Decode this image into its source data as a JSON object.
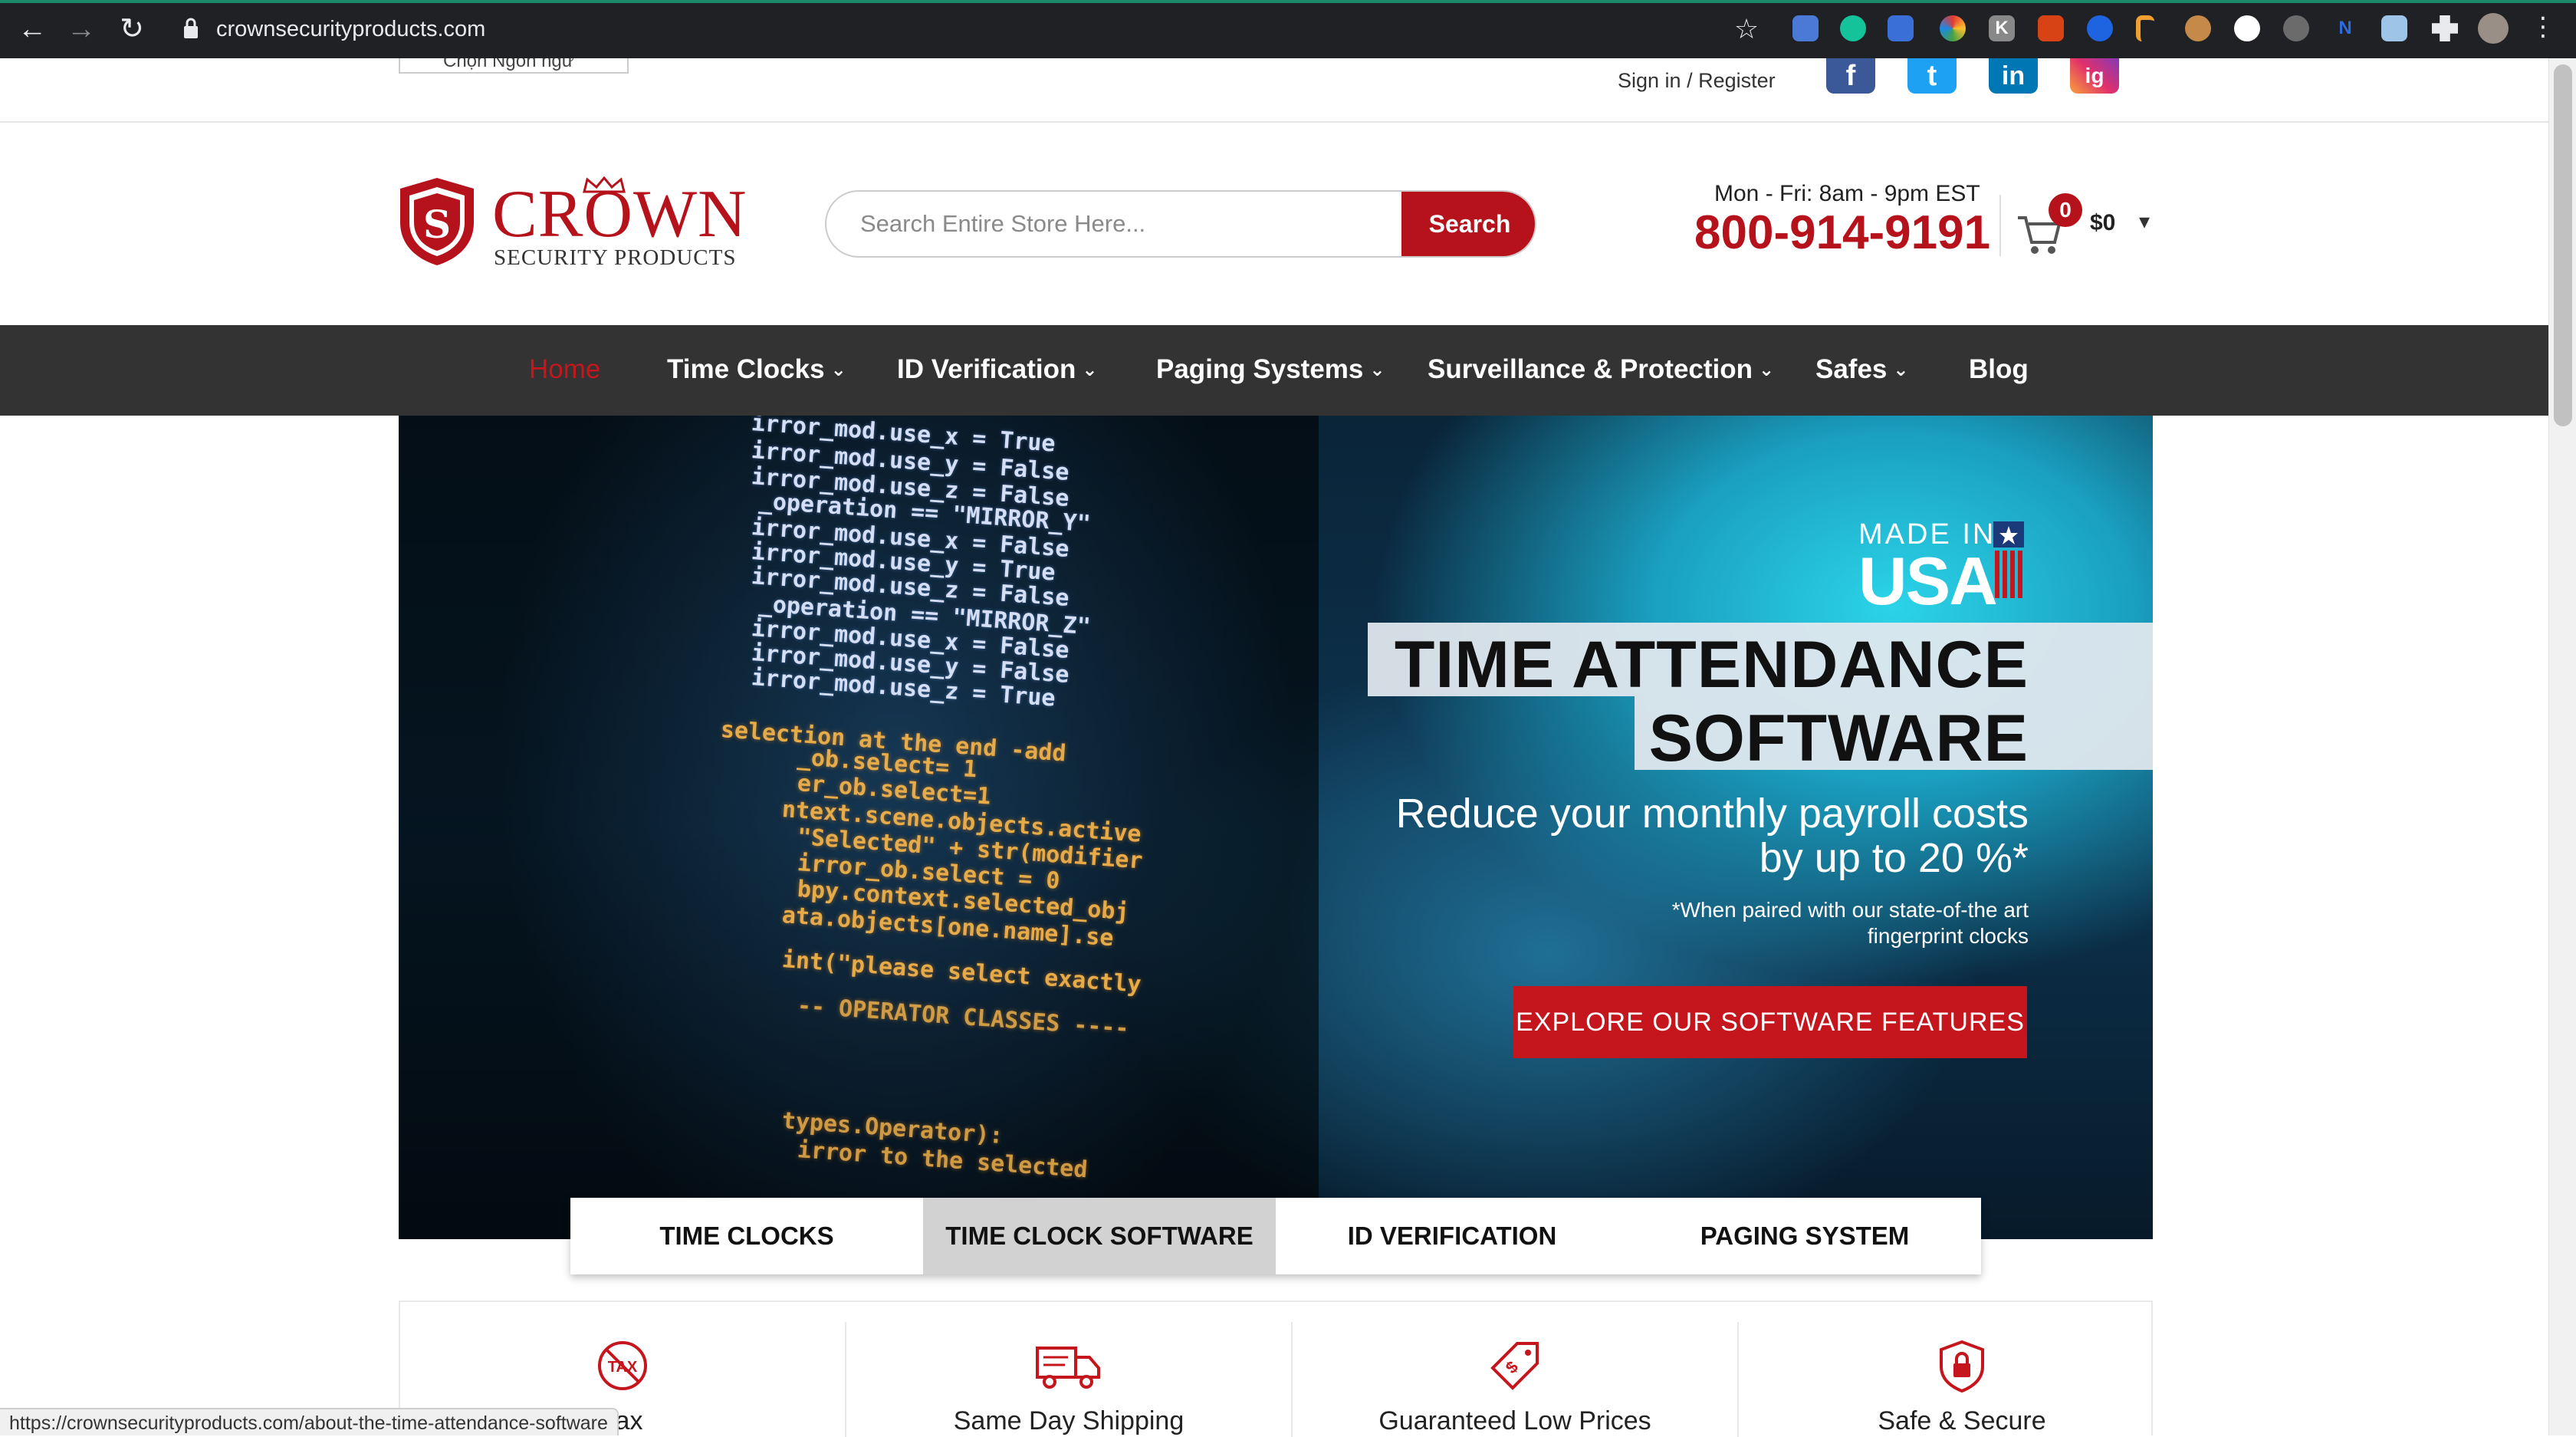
{
  "browser": {
    "url": "crownsecurityproducts.com",
    "back_icon": "←",
    "forward_icon": "→",
    "reload_icon": "↻",
    "bookmark_icon": "☆",
    "extension_initial_k": "K",
    "extension_initial_n": "N"
  },
  "topbar": {
    "language": "Chọn Ngôn ngữ",
    "sign_in": "Sign in",
    "separator": " / ",
    "register": "Register",
    "social": [
      "f",
      "t",
      "in",
      "ig"
    ]
  },
  "header": {
    "logo_main": "CROWN",
    "logo_sub": "SECURITY PRODUCTS",
    "search_placeholder": "Search Entire Store Here...",
    "search_button": "Search",
    "hours": "Mon - Fri: 8am - 9pm EST",
    "phone": "800-914-9191",
    "cart_count": "0",
    "cart_total": "$0",
    "cart_caret": "▾"
  },
  "nav": {
    "items": [
      {
        "label": "Home",
        "has_dropdown": false
      },
      {
        "label": "Time Clocks",
        "has_dropdown": true
      },
      {
        "label": "ID Verification",
        "has_dropdown": true
      },
      {
        "label": "Paging Systems",
        "has_dropdown": true
      },
      {
        "label": "Surveillance & Protection",
        "has_dropdown": true
      },
      {
        "label": "Safes",
        "has_dropdown": true
      },
      {
        "label": "Blog",
        "has_dropdown": false
      }
    ],
    "chevron": "⌄"
  },
  "hero": {
    "made_in": "MADE IN",
    "usa": "USA",
    "headline_1": "TIME ATTENDANCE",
    "headline_2": "SOFTWARE",
    "subhead_1": "Reduce your monthly payroll costs",
    "subhead_2": "by up to 20 %*",
    "footnote_1": "*When paired with our state-of-the art",
    "footnote_2": "fingerprint clocks",
    "cta": "EXPLORE OUR SOFTWARE FEATURES",
    "code_lines": [
      "irror_mod.use_x = True",
      "irror_mod.use_y = False",
      "irror_mod.use_z = False",
      "_operation == \"MIRROR_Y\"",
      "irror_mod.use_x = False",
      "irror_mod.use_y = True",
      "irror_mod.use_z = False",
      "_operation == \"MIRROR_Z\"",
      "irror_mod.use_x = False",
      "irror_mod.use_y = False",
      "irror_mod.use_z = True",
      "selection at the end -add",
      "_ob.select= 1",
      "er_ob.select=1",
      "ntext.scene.objects.active",
      "\"Selected\" + str(modifier",
      "irror_ob.select = 0",
      "bpy.context.selected_obj",
      "ata.objects[one.name].se",
      "int(\"please select exactly",
      "-- OPERATOR CLASSES ----",
      "types.Operator):",
      "irror to the selected"
    ]
  },
  "tabs": [
    {
      "label": "TIME CLOCKS",
      "active": false
    },
    {
      "label": "TIME CLOCK SOFTWARE",
      "active": true
    },
    {
      "label": "ID VERIFICATION",
      "active": false
    },
    {
      "label": "PAGING SYSTEM",
      "active": false
    }
  ],
  "features": [
    {
      "label": "Tax",
      "icon": "no-tax-icon"
    },
    {
      "label": "Same Day Shipping",
      "icon": "truck-icon"
    },
    {
      "label": "Guaranteed Low Prices",
      "icon": "price-tag-icon"
    },
    {
      "label": "Safe & Secure",
      "icon": "lock-shield-icon"
    }
  ],
  "status_bar": "https://crownsecurityproducts.com/about-the-time-attendance-software",
  "colors": {
    "brand_red": "#b5121b",
    "nav_bg": "#333333",
    "chrome_bg": "#202124"
  }
}
